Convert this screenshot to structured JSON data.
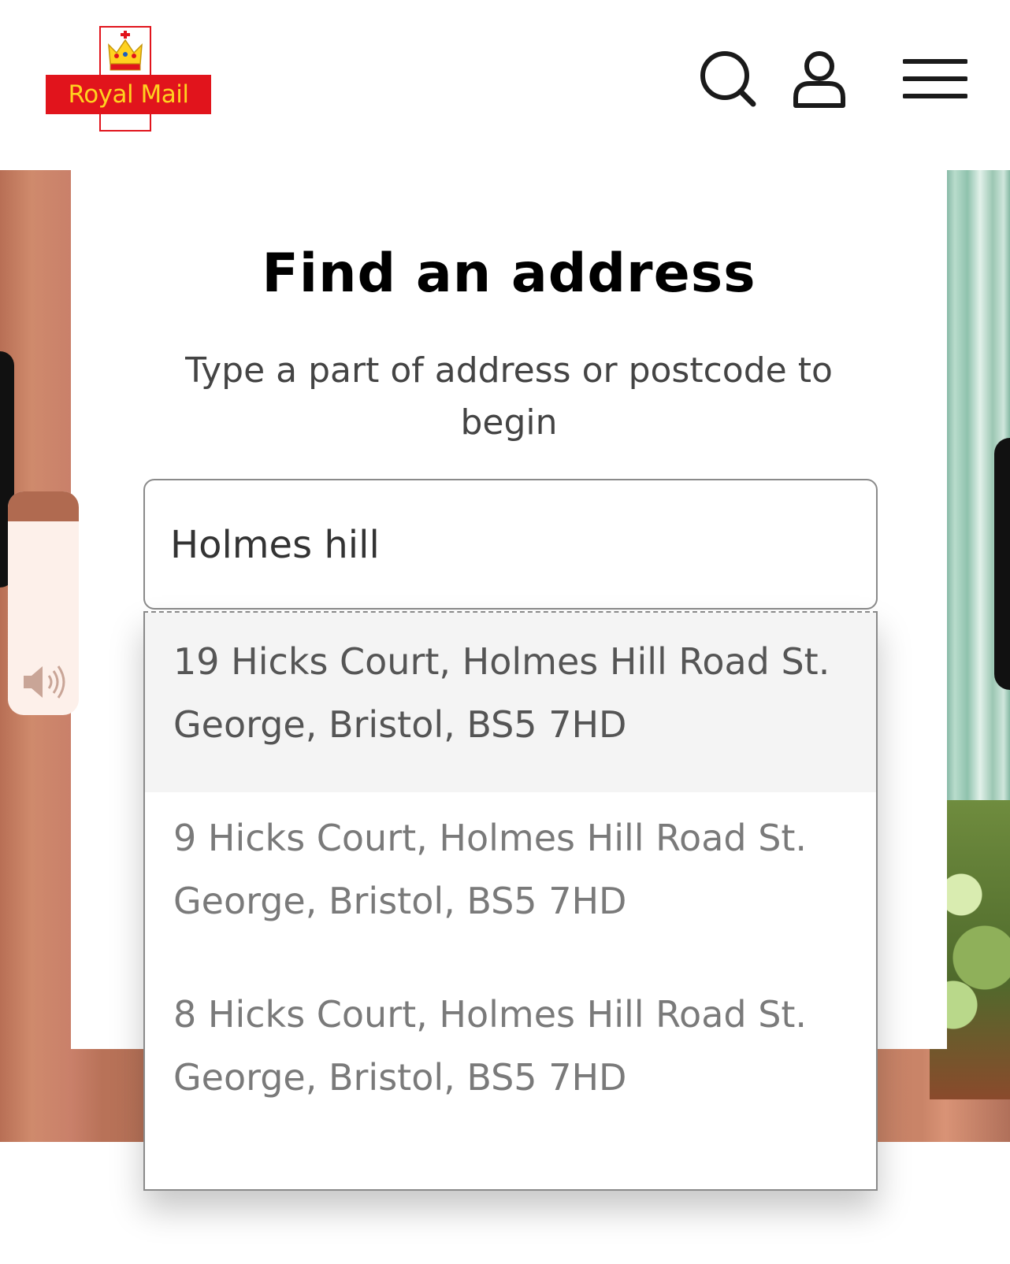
{
  "header": {
    "logo_text": "Royal Mail",
    "icons": [
      "search-icon",
      "account-icon",
      "menu-icon"
    ]
  },
  "colors": {
    "brand_red": "#e1141c",
    "brand_yellow": "#ffd21f"
  },
  "main": {
    "title": "Find an address",
    "subtitle": "Type a part of address or postcode to begin",
    "search": {
      "value": "Holmes hill"
    },
    "suggestions": [
      {
        "text": "19 Hicks Court, Holmes Hill Road  St. George, Bristol, BS5 7HD",
        "highlighted": true
      },
      {
        "text": "9 Hicks Court, Holmes Hill Road  St. George, Bristol, BS5 7HD",
        "highlighted": false
      },
      {
        "text": "8 Hicks Court, Holmes Hill Road  St. George, Bristol, BS5 7HD",
        "highlighted": false
      }
    ]
  },
  "accessibility": {
    "speaker_icon": "speaker-icon"
  }
}
